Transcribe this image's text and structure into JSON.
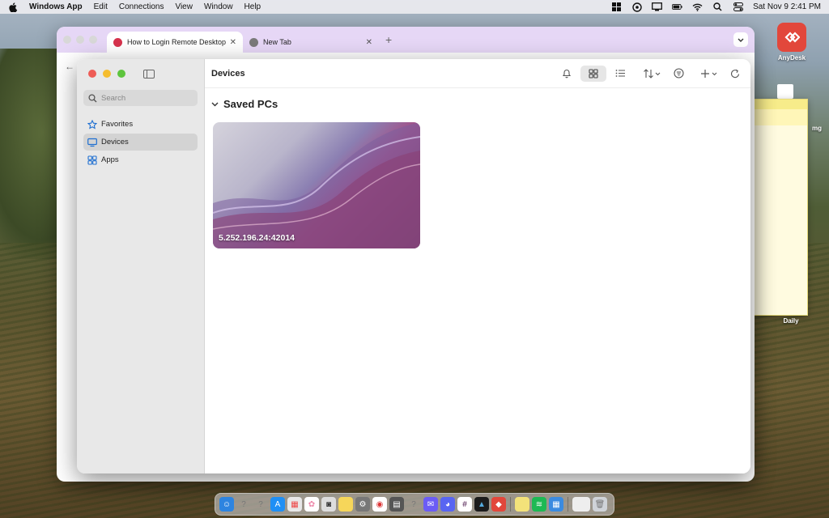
{
  "menubar": {
    "app_name": "Windows App",
    "items": [
      "Edit",
      "Connections",
      "View",
      "Window",
      "Help"
    ],
    "datetime": "Sat Nov 9  2:41 PM"
  },
  "desktop": {
    "icons": [
      {
        "label": "AnyDesk"
      },
      {
        "label": "Daily"
      },
      {
        "label": "mg"
      }
    ]
  },
  "browser": {
    "tabs": [
      {
        "title": "How to Login Remote Desktop",
        "active": true
      },
      {
        "title": "New Tab",
        "active": false
      }
    ]
  },
  "app": {
    "sidebar": {
      "search_placeholder": "Search",
      "items": [
        {
          "label": "Favorites",
          "icon": "star-icon",
          "selected": false
        },
        {
          "label": "Devices",
          "icon": "monitor-icon",
          "selected": true
        },
        {
          "label": "Apps",
          "icon": "apps-grid-icon",
          "selected": false
        }
      ]
    },
    "toolbar": {
      "title": "Devices"
    },
    "section": {
      "title": "Saved PCs"
    },
    "pcs": [
      {
        "address": "5.252.196.24:42014"
      }
    ]
  },
  "colors": {
    "accent_blue": "#1f6fd1",
    "anydesk_red": "#e2473b",
    "browser_tabbar": "#e6d7f6"
  }
}
